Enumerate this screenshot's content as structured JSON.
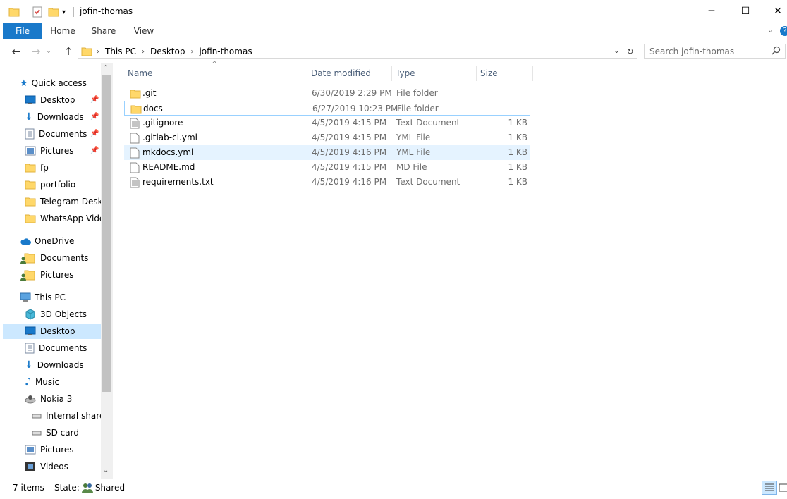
{
  "window": {
    "title": "jofin-thomas",
    "minimize": "─",
    "maximize": "☐",
    "close": "✕"
  },
  "ribbon": {
    "tabs": [
      "File",
      "Home",
      "Share",
      "View"
    ]
  },
  "address": {
    "crumbs": [
      "This PC",
      "Desktop",
      "jofin-thomas"
    ]
  },
  "search": {
    "placeholder": "Search jofin-thomas"
  },
  "nav": {
    "quick_access": "Quick access",
    "quick_items": [
      "Desktop",
      "Downloads",
      "Documents",
      "Pictures",
      "fp",
      "portfolio",
      "Telegram Desktop",
      "WhatsApp Video"
    ],
    "onedrive": "OneDrive",
    "onedrive_items": [
      "Documents",
      "Pictures"
    ],
    "this_pc": "This PC",
    "pc_items": [
      "3D Objects",
      "Desktop",
      "Documents",
      "Downloads",
      "Music",
      "Nokia 3"
    ],
    "nokia_items": [
      "Internal shared",
      "SD card"
    ],
    "pc_items_after": [
      "Pictures",
      "Videos"
    ],
    "selected": "Desktop"
  },
  "columns": {
    "name": "Name",
    "date": "Date modified",
    "type": "Type",
    "size": "Size"
  },
  "files": [
    {
      "name": ".git",
      "date": "6/30/2019 2:29 PM",
      "type": "File folder",
      "size": "",
      "icon": "folder-icon"
    },
    {
      "name": "docs",
      "date": "6/27/2019 10:23 PM",
      "type": "File folder",
      "size": "",
      "icon": "folder-icon"
    },
    {
      "name": ".gitignore",
      "date": "4/5/2019 4:15 PM",
      "type": "Text Document",
      "size": "1 KB",
      "icon": "text-file-icon"
    },
    {
      "name": ".gitlab-ci.yml",
      "date": "4/5/2019 4:15 PM",
      "type": "YML File",
      "size": "1 KB",
      "icon": "file-icon"
    },
    {
      "name": "mkdocs.yml",
      "date": "4/5/2019 4:16 PM",
      "type": "YML File",
      "size": "1 KB",
      "icon": "file-icon"
    },
    {
      "name": "README.md",
      "date": "4/5/2019 4:15 PM",
      "type": "MD File",
      "size": "1 KB",
      "icon": "file-icon"
    },
    {
      "name": "requirements.txt",
      "date": "4/5/2019 4:16 PM",
      "type": "Text Document",
      "size": "1 KB",
      "icon": "text-file-icon"
    }
  ],
  "status": {
    "count": "7 items",
    "state_label": "State:",
    "state_value": "Shared"
  },
  "colors": {
    "accent": "#1979ca",
    "selection": "#cce8ff",
    "hover": "#e5f3ff",
    "folder": "#ffd86a"
  }
}
